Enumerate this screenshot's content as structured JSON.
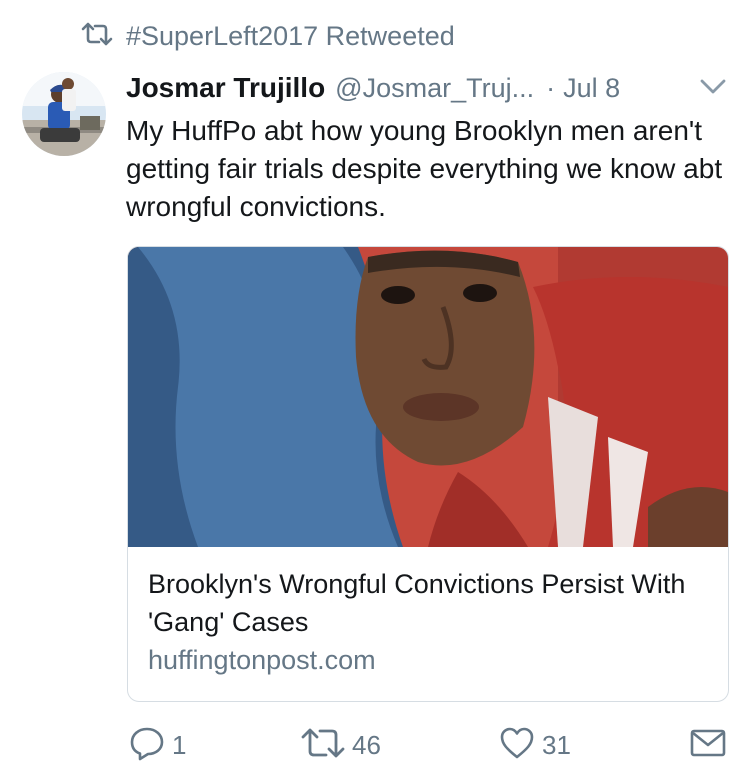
{
  "retweet_context": {
    "label": "#SuperLeft2017 Retweeted",
    "icon": "retweet-icon"
  },
  "tweet": {
    "author_name": "Josmar Trujillo",
    "author_handle": "@Josmar_Truj...",
    "separator": "·",
    "date": "Jul 8",
    "text": "My HuffPo abt how young Brooklyn men aren't getting fair trials despite everything we know abt wrongful convictions."
  },
  "card": {
    "title": "Brooklyn's Wrongful Convictions Persist With 'Gang' Cases",
    "domain": "huffingtonpost.com"
  },
  "actions": {
    "reply_count": "1",
    "retweet_count": "46",
    "like_count": "31"
  },
  "colors": {
    "text_primary": "#14171a",
    "text_secondary": "#657786",
    "border": "#d6dde3",
    "icon": "#657786"
  }
}
